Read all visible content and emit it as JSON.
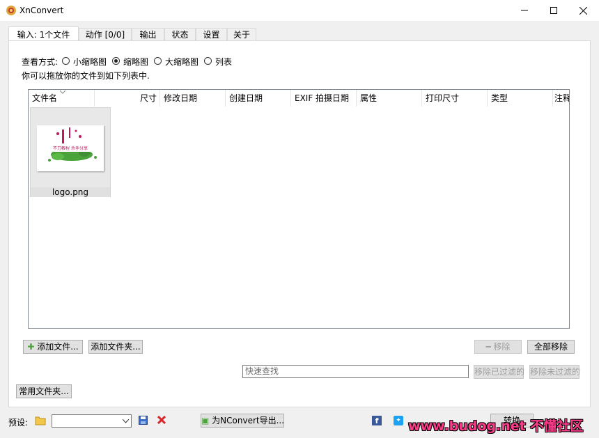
{
  "window": {
    "title": "XnConvert"
  },
  "tabs": [
    {
      "label": "输入: 1个文件"
    },
    {
      "label": "动作 [0/0]"
    },
    {
      "label": "输出"
    },
    {
      "label": "状态"
    },
    {
      "label": "设置"
    },
    {
      "label": "关于"
    }
  ],
  "view": {
    "label": "查看方式:",
    "options": [
      "小缩略图",
      "缩略图",
      "大缩略图",
      "列表"
    ],
    "selected": "缩略图",
    "hint": "你可以拖放你的文件到如下列表中."
  },
  "columns": [
    "文件名",
    "尺寸",
    "修改日期",
    "创建日期",
    "EXIF 拍摄日期",
    "属性",
    "打印尺寸",
    "类型",
    "注释"
  ],
  "files": [
    {
      "name": "logo.png",
      "logo_text": "不刀教程 杀手分享"
    }
  ],
  "buttons": {
    "add_file": "添加文件...",
    "add_folder": "添加文件夹...",
    "remove": "移除",
    "remove_all": "全部移除",
    "remove_filtered": "移除已过滤的",
    "remove_unfiltered": "移除未过滤的",
    "common_folder": "常用文件夹...",
    "export": "为NConvert导出..."
  },
  "search": {
    "placeholder": "快速查找"
  },
  "bottom": {
    "preset_label": "预设:",
    "preset_value": "",
    "convert_label": "转换",
    "watermark": "www.budog.net 不懂社区"
  },
  "colors": {
    "accent_green": "#4aa33a",
    "facebook": "#3b5998",
    "twitter": "#1da1f2",
    "delete_red": "#d9262b",
    "watermark": "#ff3b8b"
  }
}
